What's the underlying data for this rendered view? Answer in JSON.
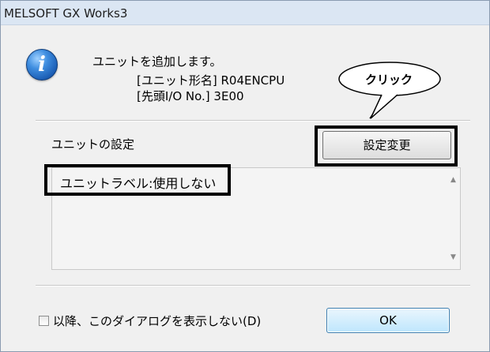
{
  "window": {
    "title": "MELSOFT GX Works3"
  },
  "message": {
    "line1": "ユニットを追加します。",
    "line2": "[ユニット形名] R04ENCPU",
    "line3": "[先頭I/O No.] 3E00"
  },
  "callout": {
    "text": "クリック"
  },
  "settings": {
    "label": "ユニットの設定",
    "change_button": "設定変更",
    "list_text": "ユニットラベル:使用しない"
  },
  "footer": {
    "checkbox_label": "以降、このダイアログを表示しない(D)",
    "checkbox_checked": false,
    "ok_button": "OK"
  }
}
